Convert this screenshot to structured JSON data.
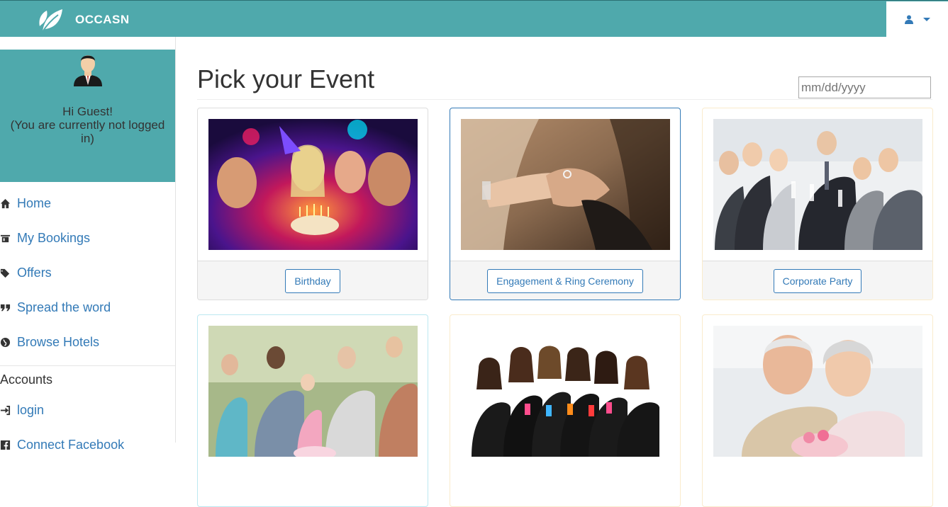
{
  "brand": {
    "name": "OCCASN"
  },
  "header": {
    "user_icon": "user-icon"
  },
  "sidebar": {
    "greeting_line1": "Hi Guest!",
    "greeting_line2": "(You are currently not logged in)",
    "items": [
      {
        "label": "Home",
        "icon": "home-icon"
      },
      {
        "label": "My Bookings",
        "icon": "bookings-icon"
      },
      {
        "label": "Offers",
        "icon": "tags-icon"
      },
      {
        "label": "Spread the word",
        "icon": "quote-icon"
      },
      {
        "label": "Browse Hotels",
        "icon": "globe-icon"
      }
    ],
    "accounts_header": "Accounts",
    "account_items": [
      {
        "label": "login",
        "icon": "sign-in-icon"
      },
      {
        "label": "Connect Facebook",
        "icon": "facebook-icon"
      }
    ]
  },
  "main": {
    "title": "Pick your Event",
    "date_placeholder": "mm/dd/yyyy",
    "events": [
      {
        "label": "Birthday"
      },
      {
        "label": "Engagement & Ring Ceremony"
      },
      {
        "label": "Corporate Party"
      }
    ]
  }
}
